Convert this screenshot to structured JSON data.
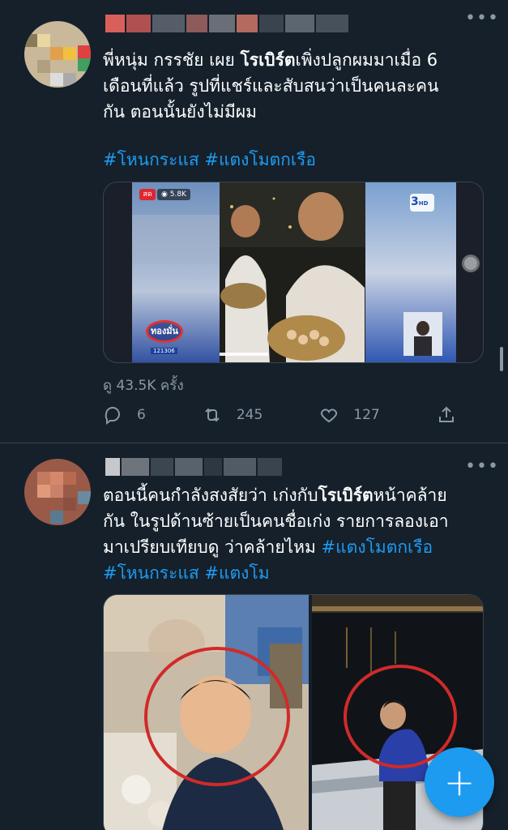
{
  "tweet1": {
    "text_line1_pre": "พี่หนุ่ม กรรชัย เผย ",
    "text_line1_bold": "โรเบิร์ต",
    "text_line1_post": "เพิ่งปลูกผมมาเมื่อ 6",
    "text_line2": "เดือนที่แล้ว รูปที่แชร์และสับสนว่าเป็นคนละคน",
    "text_line3": "กัน ตอนนั้นยังไม่มีผม",
    "hashtag1": "#โหนกระแส",
    "hashtag2": "#แตงโมตกเรือ",
    "video": {
      "live_badge": "สด",
      "viewers": "5.8K",
      "logo_text": "ทองมั่น",
      "channel_number": "121306"
    },
    "views": "ดู 43.5K ครั้ง",
    "reply_count": "6",
    "retweet_count": "245",
    "like_count": "127"
  },
  "tweet2": {
    "line1_pre": "ตอนนี้คนกำลังสงสัยว่า เก่งกับ",
    "line1_bold": "โรเบิร์ต",
    "line1_post": "หน้าคล้าย",
    "line2": "กัน  ในรูปด้านซ้ายเป็นคนชื่อเก่ง รายการลองเอา",
    "line3_pre": "มาเปรียบเทียบดู ว่าคล้ายไหม ",
    "line3_tag": "#แตงโมตกเรือ",
    "line4_tag1": "#โหนกระแส",
    "line4_tag2": "#แตงโม"
  },
  "fab": {
    "label": "+"
  },
  "colors": {
    "background": "#15202b",
    "accent": "#1d9bf0",
    "muted": "#8b98a5",
    "divider": "#38444d"
  }
}
